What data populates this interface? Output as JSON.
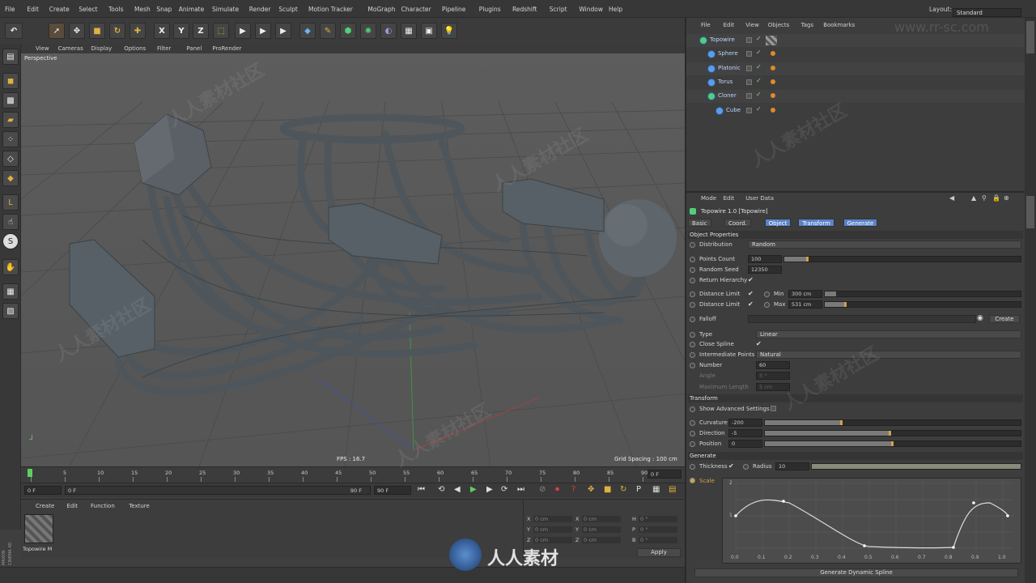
{
  "menubar": {
    "items": [
      "File",
      "Edit",
      "Create",
      "Select",
      "Tools",
      "Mesh",
      "Snap",
      "Animate",
      "Simulate",
      "Render",
      "Sculpt",
      "Motion Tracker",
      "MoGraph",
      "Character",
      "Pipeline",
      "Plugins",
      "Redshift",
      "Script",
      "Window",
      "Help"
    ],
    "layout_label": "Layout:",
    "layout_value": "Standard"
  },
  "toolbar": {
    "axis_x": "X",
    "axis_y": "Y",
    "axis_z": "Z"
  },
  "viewport_menu": [
    "View",
    "Cameras",
    "Display",
    "Options",
    "Filter",
    "Panel",
    "ProRender"
  ],
  "viewport": {
    "label": "Perspective",
    "fps": "FPS : 16.7",
    "grid_spacing": "Grid Spacing : 100 cm"
  },
  "timeline": {
    "ticks": [
      "0",
      "5",
      "10",
      "15",
      "20",
      "25",
      "30",
      "35",
      "40",
      "45",
      "50",
      "55",
      "60",
      "65",
      "70",
      "75",
      "80",
      "85",
      "90"
    ],
    "current_frame": "0 F",
    "start_field": "0 F",
    "min_field": "0 F",
    "max_field": "90 F",
    "end_field": "90 F"
  },
  "material_manager": {
    "menu": [
      "Create",
      "Edit",
      "Function",
      "Texture"
    ],
    "material_name": "Topowire M"
  },
  "coord_manager": {
    "rows": [
      {
        "axis": "X",
        "value": "0 cm",
        "axis2": "X",
        "value2": "0 cm",
        "axis3": "H",
        "value3": "0 °"
      },
      {
        "axis": "Y",
        "value": "0 cm",
        "axis2": "Y",
        "value2": "0 cm",
        "axis3": "P",
        "value3": "0 °"
      },
      {
        "axis": "Z",
        "value": "0 cm",
        "axis2": "Z",
        "value2": "0 cm",
        "axis3": "B",
        "value3": "0 °"
      }
    ],
    "apply": "Apply"
  },
  "brand": {
    "line1": "MAXON",
    "line2": "CINEMA 4D"
  },
  "object_manager": {
    "menu": [
      "File",
      "Edit",
      "View",
      "Objects",
      "Tags",
      "Bookmarks"
    ],
    "objects": [
      {
        "name": "Topowire",
        "indent": 0
      },
      {
        "name": "Sphere",
        "indent": 1
      },
      {
        "name": "Platonic",
        "indent": 1
      },
      {
        "name": "Torus",
        "indent": 1
      },
      {
        "name": "Cloner",
        "indent": 1
      },
      {
        "name": "Cube",
        "indent": 2
      }
    ]
  },
  "attributes": {
    "menu": [
      "Mode",
      "Edit",
      "User Data"
    ],
    "title": "Topowire 1.0 [Topowire]",
    "tabs": [
      "Basic",
      "Coord.",
      "Object",
      "Transform",
      "Generate"
    ],
    "section_object": "Object Properties",
    "distribution_label": "Distribution",
    "distribution_value": "Random",
    "points_count_label": "Points Count",
    "points_count_value": "100",
    "points_count_fill": 0.1,
    "random_seed_label": "Random Seed",
    "random_seed_value": "12350",
    "return_hierarchy_label": "Return Hierarchy",
    "distance_limit_label": "Distance Limit",
    "min_label": "Min",
    "min_value": "300 cm",
    "max_label": "Max",
    "max_value": "531 cm",
    "falloff_label": "Falloff",
    "create_label": "Create",
    "type_label": "Type",
    "type_value": "Linear",
    "close_spline_label": "Close Spline",
    "intermediate_label": "Intermediate Points",
    "intermediate_value": "Natural",
    "number_label": "Number",
    "number_value": "60",
    "angle_label": "Angle",
    "angle_value": "5 °",
    "max_length_label": "Maximum Length",
    "max_length_value": "5 cm",
    "section_transform": "Transform",
    "show_advanced_label": "Show Advanced Settings",
    "curvature_label": "Curvature",
    "curvature_value": "-200",
    "curvature_fill": 0.3,
    "direction_label": "Direction",
    "direction_value": "-5",
    "direction_fill": 0.49,
    "position_label": "Position",
    "position_value": "0",
    "position_fill": 0.5,
    "section_generate": "Generate",
    "thickness_label": "Thickness",
    "radius_label": "Radius",
    "radius_value": "10",
    "scale_label": "Scale",
    "graph_y_top": "2",
    "graph_y_mid": "1",
    "graph_x_ticks": [
      "0.0",
      "0.1",
      "0.2",
      "0.3",
      "0.4",
      "0.5",
      "0.6",
      "0.7",
      "0.8",
      "0.9",
      "1.0"
    ],
    "generate_button": "Generate Dynamic Spline"
  },
  "watermark": {
    "text": "人人素材社区",
    "url": "www.rr-sc.com",
    "logo_text": "人人素材"
  },
  "colors": {
    "accent": "#5a83c7",
    "slider_knob": "#d3a24a",
    "tag_orange": "#e08a2a"
  }
}
